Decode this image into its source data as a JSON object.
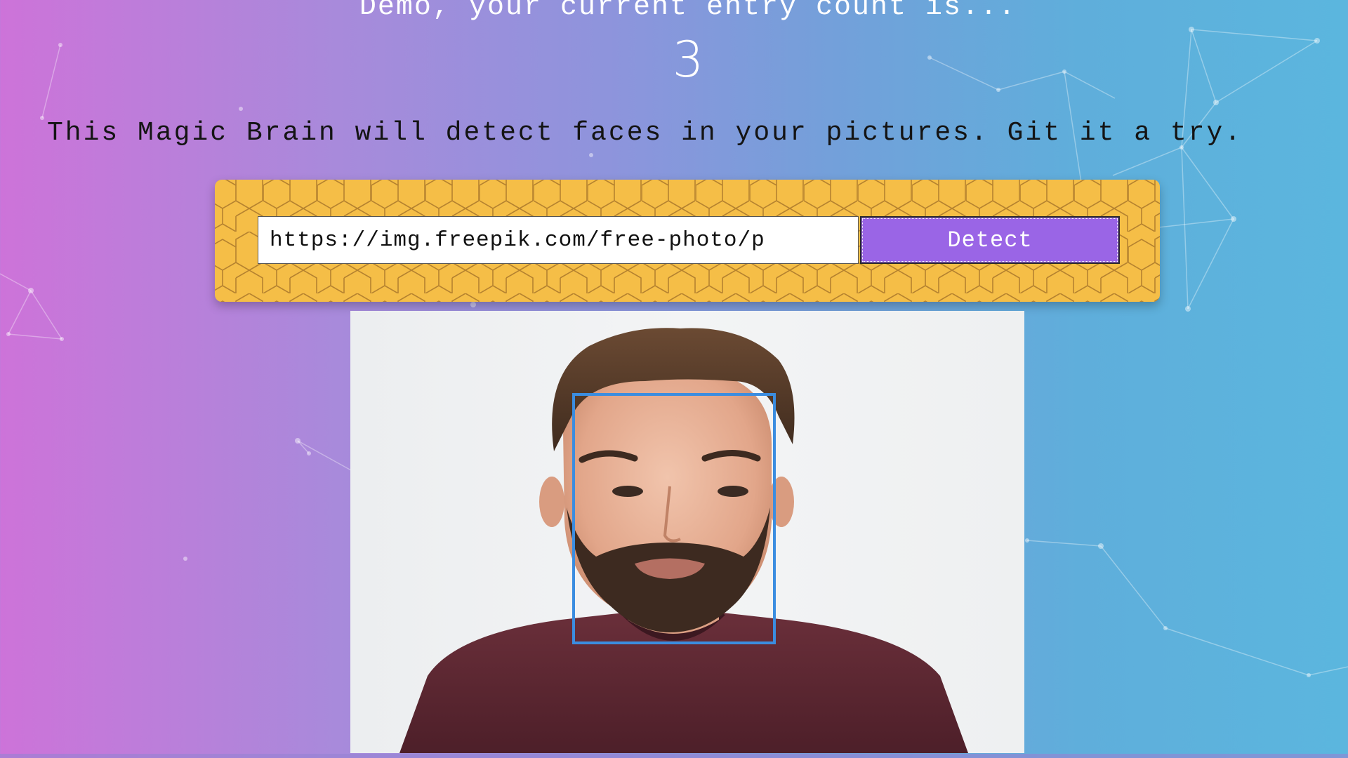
{
  "header": {
    "greeting": "Demo, your current entry count is...",
    "entry_count": "3"
  },
  "tagline": "This Magic Brain will detect faces in your pictures. Git it a try.",
  "form": {
    "url_value": "https://img.freepik.com/free-photo/p",
    "detect_label": "Detect"
  },
  "colors": {
    "background_left": "#cd73d9",
    "background_right": "#5bb6de",
    "panel": "#f5be47",
    "button": "#9a65e6",
    "face_box": "#3b8de0"
  }
}
